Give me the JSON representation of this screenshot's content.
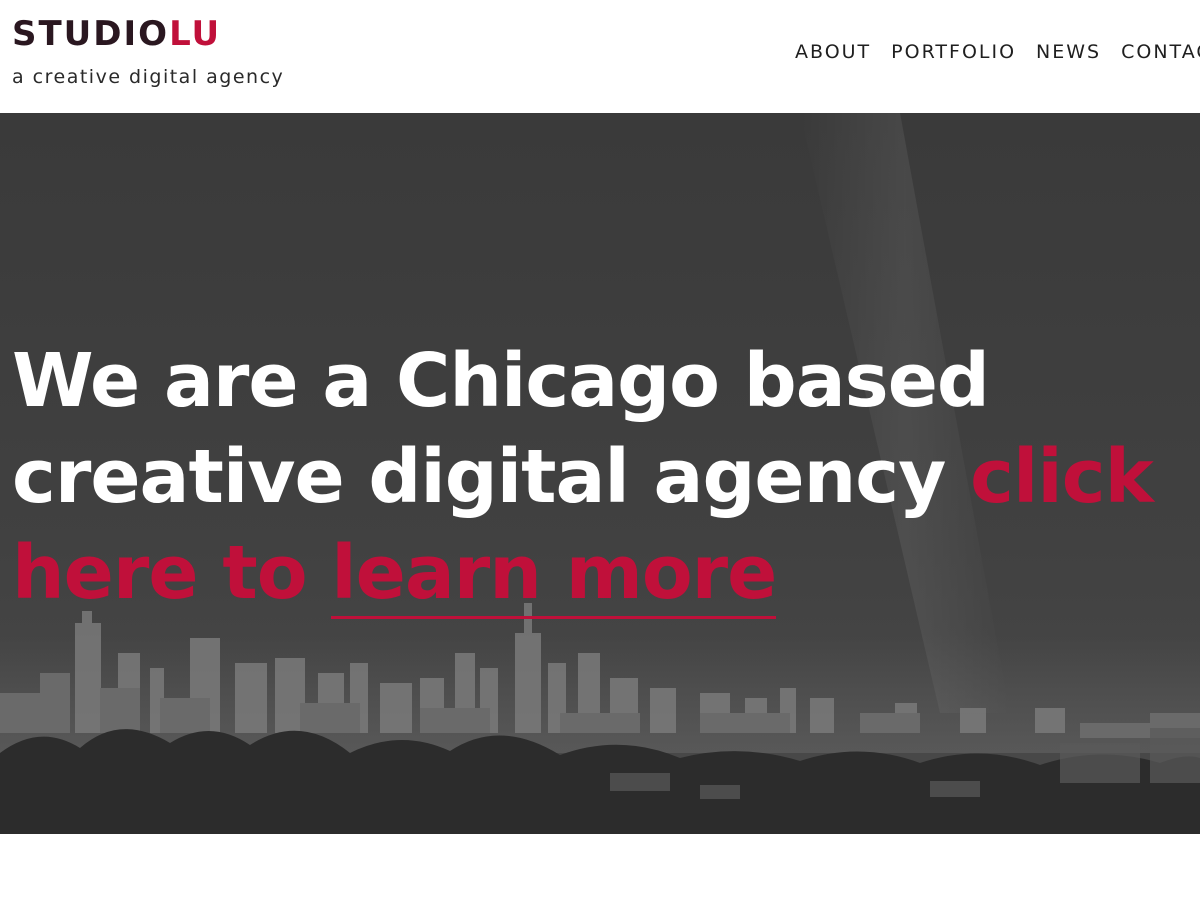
{
  "brand": {
    "logo_part1": "STUDIO",
    "logo_part2": "LU",
    "tagline": "a creative digital agency",
    "accent_color": "#c0103a",
    "dark_color": "#2a1720"
  },
  "nav": {
    "items": [
      {
        "label": "ABOUT"
      },
      {
        "label": "PORTFOLIO"
      },
      {
        "label": "NEWS"
      },
      {
        "label": "CONTACT"
      }
    ]
  },
  "hero": {
    "line1": "We are a Chicago based",
    "line2_text": "creative digital agency ",
    "line2_accent": "click",
    "line3_accent": "here to ",
    "line3_link": "learn more",
    "background": "chicago-skyline-grayscale"
  }
}
